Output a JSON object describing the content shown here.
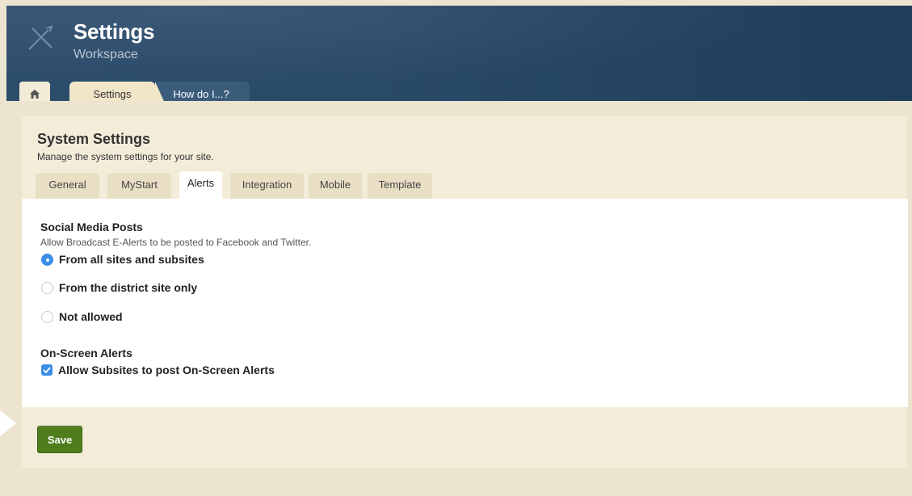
{
  "header": {
    "title": "Settings",
    "subtitle": "Workspace",
    "logo_icon": "tools-icon"
  },
  "top_tabs": [
    {
      "label": "Settings",
      "active": true
    },
    {
      "label": "How do I...?",
      "active": false
    }
  ],
  "home_icon": "home-icon",
  "panel": {
    "title": "System Settings",
    "description": "Manage the system settings for your site."
  },
  "sub_tabs": [
    {
      "label": "General"
    },
    {
      "label": "MyStart"
    },
    {
      "label": "Alerts",
      "active": true
    },
    {
      "label": "Integration"
    },
    {
      "label": "Mobile"
    },
    {
      "label": "Template"
    }
  ],
  "social": {
    "title": "Social Media Posts",
    "description": "Allow Broadcast E-Alerts to be posted to Facebook and Twitter.",
    "options": [
      {
        "label": "From all sites and subsites",
        "checked": true
      },
      {
        "label": "From the district site only",
        "checked": false
      },
      {
        "label": "Not allowed",
        "checked": false
      }
    ]
  },
  "onscreen": {
    "title": "On-Screen Alerts",
    "checkbox_label": "Allow Subsites to post On-Screen Alerts",
    "checked": true
  },
  "save_label": "Save",
  "colors": {
    "header": "#2a4a6a",
    "accent_blue": "#3a8ee6",
    "save_green": "#4f7d1c",
    "page_bg": "#ece4cf"
  }
}
